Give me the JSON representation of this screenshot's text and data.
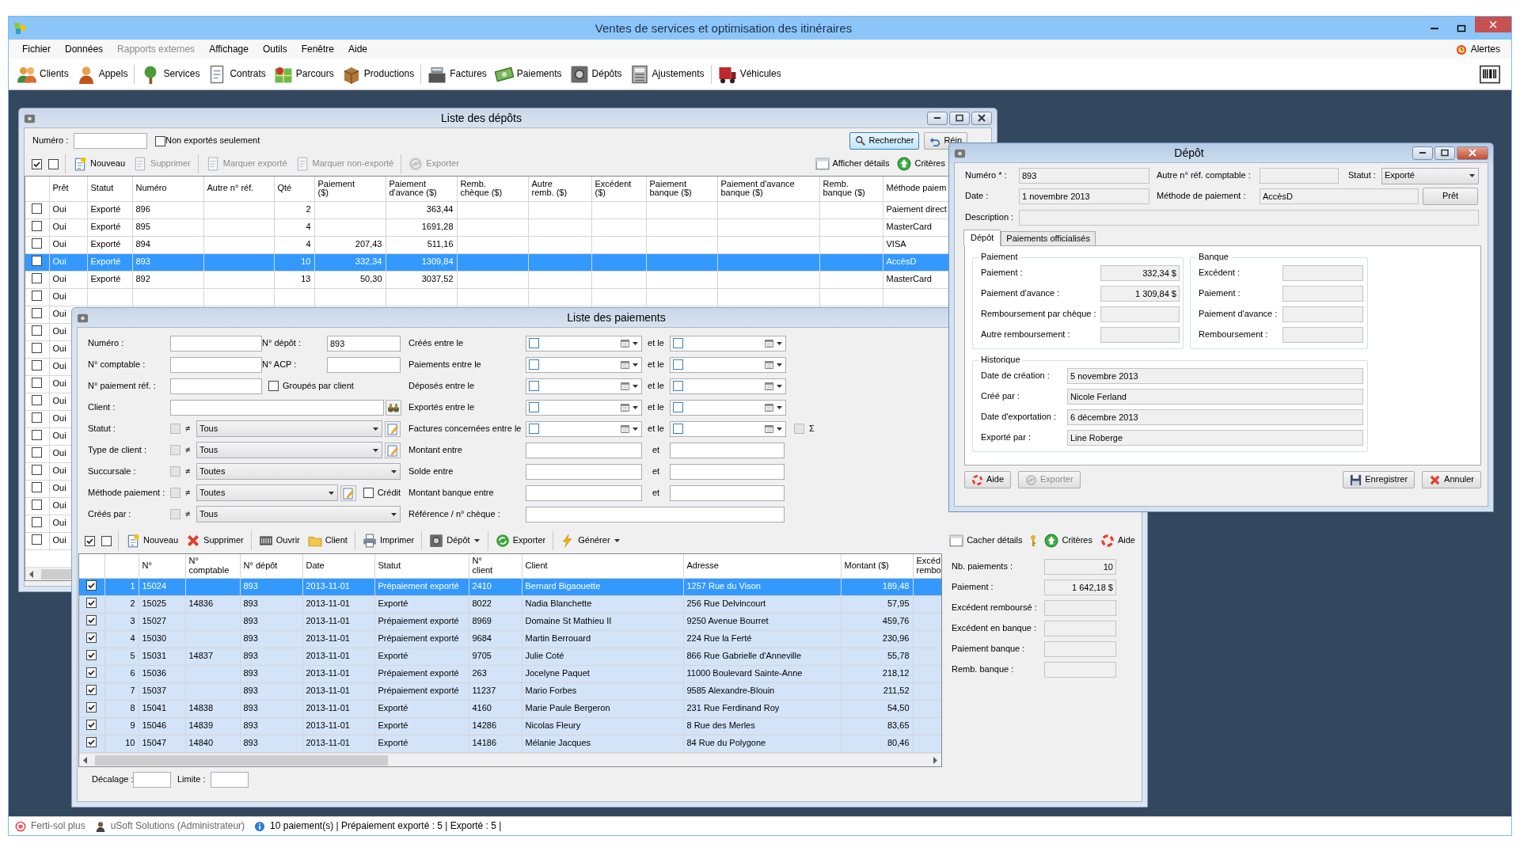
{
  "app": {
    "title": "Ventes de services et optimisation des itinéraires",
    "menu": [
      {
        "label": "Fichier",
        "disabled": false
      },
      {
        "label": "Données",
        "disabled": false
      },
      {
        "label": "Rapports externes",
        "disabled": true
      },
      {
        "label": "Affichage",
        "disabled": false
      },
      {
        "label": "Outils",
        "disabled": false
      },
      {
        "label": "Fenêtre",
        "disabled": false
      },
      {
        "label": "Aide",
        "disabled": false
      }
    ],
    "alerts": "Alertes",
    "toolbar_groups": [
      [
        "Clients",
        "Appels"
      ],
      [
        "Services",
        "Contrats",
        "Parcours",
        "Productions"
      ],
      [
        "Factures",
        "Paiements",
        "Dépôts",
        "Ajustements"
      ],
      [
        "Véhicules"
      ]
    ]
  },
  "depots_window": {
    "title": "Liste des dépôts",
    "number_label": "Numéro :",
    "unexported_only": {
      "label": "Non exportés seulement",
      "checked": false
    },
    "search": "Rechercher",
    "reset": "Réin",
    "select_boxes": [
      {
        "checked": true
      },
      {
        "checked": false
      }
    ],
    "action_groups": [
      [
        {
          "label": "Nouveau",
          "disabled": false
        },
        {
          "label": "Supprimer",
          "disabled": true
        }
      ],
      [
        {
          "label": "Marquer exporté",
          "disabled": true
        },
        {
          "label": "Marquer non-exporté",
          "disabled": true
        }
      ],
      [
        {
          "label": "Exporter",
          "disabled": true
        }
      ]
    ],
    "right_actions": [
      {
        "label": "Afficher détails",
        "disabled": false
      },
      {
        "label": "Critères",
        "disabled": false
      }
    ],
    "columns": [
      "Prêt",
      "Statut",
      "Numéro",
      "Autre n° réf.",
      "Qté",
      "Paiement\n($)",
      "Paiement\nd'avance ($)",
      "Remb.\nchèque ($)",
      "Autre\nremb. ($)",
      "Excédent\n($)",
      "Paiement\nbanque ($)",
      "Paiement d'avance\nbanque ($)",
      "Remb.\nbanque ($)",
      "Méthode paiem"
    ],
    "rows": [
      {
        "checked": false,
        "selected": false,
        "cells": [
          "Oui",
          "Exporté",
          "896",
          null,
          "2",
          null,
          "363,44",
          null,
          null,
          null,
          null,
          null,
          null,
          "Paiement direct"
        ]
      },
      {
        "checked": false,
        "selected": false,
        "cells": [
          "Oui",
          "Exporté",
          "895",
          null,
          "4",
          null,
          "1691,28",
          null,
          null,
          null,
          null,
          null,
          null,
          "MasterCard"
        ]
      },
      {
        "checked": false,
        "selected": false,
        "cells": [
          "Oui",
          "Exporté",
          "894",
          null,
          "4",
          "207,43",
          "511,16",
          null,
          null,
          null,
          null,
          null,
          null,
          "VISA"
        ]
      },
      {
        "checked": false,
        "selected": true,
        "cells": [
          "Oui",
          "Exporté",
          "893",
          null,
          "10",
          "332,34",
          "1309,84",
          null,
          null,
          null,
          null,
          null,
          null,
          "AccèsD"
        ]
      },
      {
        "checked": false,
        "selected": false,
        "cells": [
          "Oui",
          "Exporté",
          "892",
          null,
          "13",
          "50,30",
          "3037,52",
          null,
          null,
          null,
          null,
          null,
          null,
          "MasterCard"
        ]
      },
      {
        "checked": false,
        "selected": false,
        "cells": [
          "Oui"
        ]
      },
      {
        "checked": false,
        "selected": false,
        "cells": [
          "Oui"
        ]
      },
      {
        "checked": false,
        "selected": false,
        "cells": [
          "Oui"
        ]
      },
      {
        "checked": false,
        "selected": false,
        "cells": [
          "Oui"
        ]
      },
      {
        "checked": false,
        "selected": false,
        "cells": [
          "Oui"
        ]
      },
      {
        "checked": false,
        "selected": false,
        "cells": [
          "Oui"
        ]
      },
      {
        "checked": false,
        "selected": false,
        "cells": [
          "Oui"
        ]
      },
      {
        "checked": false,
        "selected": false,
        "cells": [
          "Oui"
        ]
      },
      {
        "checked": false,
        "selected": false,
        "cells": [
          "Oui"
        ]
      },
      {
        "checked": false,
        "selected": false,
        "cells": [
          "Oui"
        ]
      },
      {
        "checked": false,
        "selected": false,
        "cells": [
          "Oui"
        ]
      },
      {
        "checked": false,
        "selected": false,
        "cells": [
          "Oui"
        ]
      },
      {
        "checked": false,
        "selected": false,
        "cells": [
          "Oui"
        ]
      },
      {
        "checked": false,
        "selected": false,
        "cells": [
          "Oui"
        ]
      },
      {
        "checked": false,
        "selected": false,
        "cells": [
          "Oui"
        ]
      }
    ]
  },
  "payments_window": {
    "title": "Liste des paiements",
    "filters": {
      "left": [
        {
          "kind": "pair",
          "fields": [
            {
              "label": "Numéro :"
            },
            {
              "label": "N° dépôt :",
              "value": "893"
            }
          ]
        },
        {
          "kind": "pair",
          "fields": [
            {
              "label": "N° comptable :"
            },
            {
              "label": "N° ACP :"
            }
          ]
        },
        {
          "kind": "check",
          "label": "N° paiement réf. :",
          "option": {
            "label": "Groupés par client",
            "checked": false
          }
        },
        {
          "kind": "search",
          "label": "Client :"
        },
        {
          "kind": "select",
          "label": "Statut :",
          "symbol": "≠",
          "excluded": false,
          "value": "Tous",
          "edit": true
        },
        {
          "kind": "select",
          "label": "Type de client :",
          "symbol": "≠",
          "excluded": false,
          "value": "Tous",
          "edit": true
        },
        {
          "kind": "select",
          "label": "Succursale :",
          "symbol": "≠",
          "excluded": false,
          "value": "Toutes",
          "edit": false
        },
        {
          "kind": "select",
          "label": "Méthode paiement :",
          "symbol": "≠",
          "excluded": false,
          "value": "Toutes",
          "edit": true,
          "option": {
            "label": "Crédit",
            "checked": false
          }
        },
        {
          "kind": "select",
          "label": "Créés par :",
          "symbol": "≠",
          "excluded": false,
          "value": "Tous",
          "edit": false
        }
      ],
      "right": [
        {
          "kind": "dates",
          "label": "Créés entre le",
          "and": "et le",
          "from_checked": false,
          "to_checked": false
        },
        {
          "kind": "dates",
          "label": "Paiements entre le",
          "and": "et le",
          "from_checked": false,
          "to_checked": false
        },
        {
          "kind": "dates",
          "label": "Déposés entre le",
          "and": "et le",
          "from_checked": false,
          "to_checked": false
        },
        {
          "kind": "dates",
          "label": "Exportés entre le",
          "and": "et le",
          "from_checked": false,
          "to_checked": false
        },
        {
          "kind": "dates",
          "label": "Factures concernées entre le",
          "and": "et le",
          "from_checked": false,
          "to_checked": false,
          "sum": {
            "symbol": "Σ",
            "checked": false
          }
        },
        {
          "kind": "range",
          "label": "Montant entre",
          "and": "et"
        },
        {
          "kind": "range",
          "label": "Solde entre",
          "and": "et"
        },
        {
          "kind": "range",
          "label": "Montant banque entre",
          "and": "et"
        },
        {
          "kind": "text",
          "label": "Référence / n° chèque :"
        }
      ]
    },
    "select_boxes": [
      {
        "checked": true
      },
      {
        "checked": false
      }
    ],
    "action_groups": [
      [
        {
          "label": "Nouveau",
          "dropdown": false
        },
        {
          "label": "Supprimer",
          "dropdown": false
        }
      ],
      [
        {
          "label": "Ouvrir",
          "dropdown": false
        },
        {
          "label": "Client",
          "dropdown": false
        }
      ],
      [
        {
          "label": "Imprimer",
          "dropdown": false
        }
      ],
      [
        {
          "label": "Dépôt",
          "dropdown": true
        }
      ],
      [
        {
          "label": "Exporter",
          "dropdown": false
        }
      ],
      [
        {
          "label": "Générer",
          "dropdown": true
        }
      ]
    ],
    "right_actions": [
      {
        "kind": "text",
        "label": "Cacher détails"
      },
      {
        "kind": "icon"
      },
      {
        "kind": "text",
        "label": "Critères"
      },
      {
        "kind": "text",
        "label": "Aide"
      }
    ],
    "columns": [
      "N°",
      "N°\ncomptable",
      "N° dépôt",
      "Date",
      "Statut",
      "N°\nclient",
      "Client",
      "Adresse",
      "Montant ($)",
      "Excéd\nrembo"
    ],
    "rows": [
      {
        "index": "1",
        "checked": true,
        "selected": true,
        "cells": [
          "15024",
          null,
          "893",
          "2013-11-01",
          "Prépaiement exporté",
          "2410",
          "Bernard Bigaouette",
          "1257 Rue du Vison",
          "189,48"
        ]
      },
      {
        "index": "2",
        "checked": true,
        "selected": false,
        "cells": [
          "15025",
          "14836",
          "893",
          "2013-11-01",
          "Exporté",
          "8022",
          "Nadia Blanchette",
          "256 Rue Delvincourt",
          "57,95"
        ]
      },
      {
        "index": "3",
        "checked": true,
        "selected": false,
        "cells": [
          "15027",
          null,
          "893",
          "2013-11-01",
          "Prépaiement exporté",
          "8969",
          "Domaine St Mathieu II",
          "9250 Avenue Bourret",
          "459,76"
        ]
      },
      {
        "index": "4",
        "checked": true,
        "selected": false,
        "cells": [
          "15030",
          null,
          "893",
          "2013-11-01",
          "Prépaiement exporté",
          "9684",
          "Martin Berrouard",
          "224 Rue la Ferté",
          "230,96"
        ]
      },
      {
        "index": "5",
        "checked": true,
        "selected": false,
        "cells": [
          "15031",
          "14837",
          "893",
          "2013-11-01",
          "Exporté",
          "9705",
          "Julie Coté",
          "866 Rue Gabrielle d'Anneville",
          "55,78"
        ]
      },
      {
        "index": "6",
        "checked": true,
        "selected": false,
        "cells": [
          "15036",
          null,
          "893",
          "2013-11-01",
          "Prépaiement exporté",
          "263",
          "Jocelyne Paquet",
          "11000 Boulevard Sainte-Anne",
          "218,12"
        ]
      },
      {
        "index": "7",
        "checked": true,
        "selected": false,
        "cells": [
          "15037",
          null,
          "893",
          "2013-11-01",
          "Prépaiement exporté",
          "11237",
          "Mario Forbes",
          "9585 Alexandre-Blouin",
          "211,52"
        ]
      },
      {
        "index": "8",
        "checked": true,
        "selected": false,
        "cells": [
          "15041",
          "14838",
          "893",
          "2013-11-01",
          "Exporté",
          "4160",
          "Marie Paule Bergeron",
          "231 Rue Ferdinand Roy",
          "54,50"
        ]
      },
      {
        "index": "9",
        "checked": true,
        "selected": false,
        "cells": [
          "15046",
          "14839",
          "893",
          "2013-11-01",
          "Exporté",
          "14286",
          "Nicolas Fleury",
          "8 Rue des Merles",
          "83,65"
        ]
      },
      {
        "index": "10",
        "checked": true,
        "selected": false,
        "cells": [
          "15047",
          "14840",
          "893",
          "2013-11-01",
          "Exporté",
          "14186",
          "Mélanie Jacques",
          "84 Rue du Polygone",
          "80,46"
        ]
      }
    ],
    "details": [
      {
        "label": "Nb. paiements :",
        "value": "10"
      },
      {
        "label": "Paiement :",
        "value": "1 642,18 $"
      },
      {
        "label": "Excédent remboursé :"
      },
      {
        "label": "Excédent en banque :"
      },
      {
        "label": "Paiement banque :"
      },
      {
        "label": "Remb. banque :"
      }
    ],
    "offset_label": "Décalage :",
    "limit_label": "Limite :"
  },
  "deposit_window": {
    "title": "Dépôt",
    "number": {
      "label": "Numéro * :",
      "value": "893"
    },
    "other_ref": {
      "label": "Autre n° réf. comptable :"
    },
    "status": {
      "label": "Statut :",
      "value": "Exporté"
    },
    "date": {
      "label": "Date :",
      "value": "1 novembre 2013"
    },
    "method": {
      "label": "Méthode de paiement :",
      "value": "AccèsD"
    },
    "ready_button": "Prêt",
    "description": {
      "label": "Description :"
    },
    "tabs": [
      {
        "label": "Dépôt",
        "selected": true
      },
      {
        "label": "Paiements officialisés",
        "selected": false
      }
    ],
    "payment_group": {
      "title": "Paiement",
      "rows": [
        {
          "label": "Paiement :",
          "value": "332,34 $"
        },
        {
          "label": "Paiement d'avance :",
          "value": "1 309,84 $"
        },
        {
          "label": "Remboursement par chèque :"
        },
        {
          "label": "Autre remboursement :"
        }
      ]
    },
    "bank_group": {
      "title": "Banque",
      "rows": [
        {
          "label": "Excédent :"
        },
        {
          "label": "Paiement :"
        },
        {
          "label": "Paiement d'avance :"
        },
        {
          "label": "Remboursement :"
        }
      ]
    },
    "history_group": {
      "title": "Historique",
      "rows": [
        {
          "label": "Date de création :",
          "value": "5 novembre 2013"
        },
        {
          "label": "Créé par :",
          "value": "Nicole Ferland"
        },
        {
          "label": "Date d'exportation :",
          "value": "6 décembre 2013"
        },
        {
          "label": "Exporté par :",
          "value": "Line Roberge"
        }
      ]
    },
    "buttons_left": [
      {
        "label": "Aide",
        "disabled": false
      },
      {
        "label": "Exporter",
        "disabled": true
      }
    ],
    "buttons_right": [
      {
        "label": "Enregistrer",
        "disabled": false
      },
      {
        "label": "Annuler",
        "disabled": false
      }
    ]
  },
  "status_bar": {
    "company": "Ferti-sol plus",
    "user": "uSoft Solutions (Administrateur)",
    "summary": "10 paiement(s) | Prépaiement exporté : 5 | Exporté : 5 |"
  }
}
